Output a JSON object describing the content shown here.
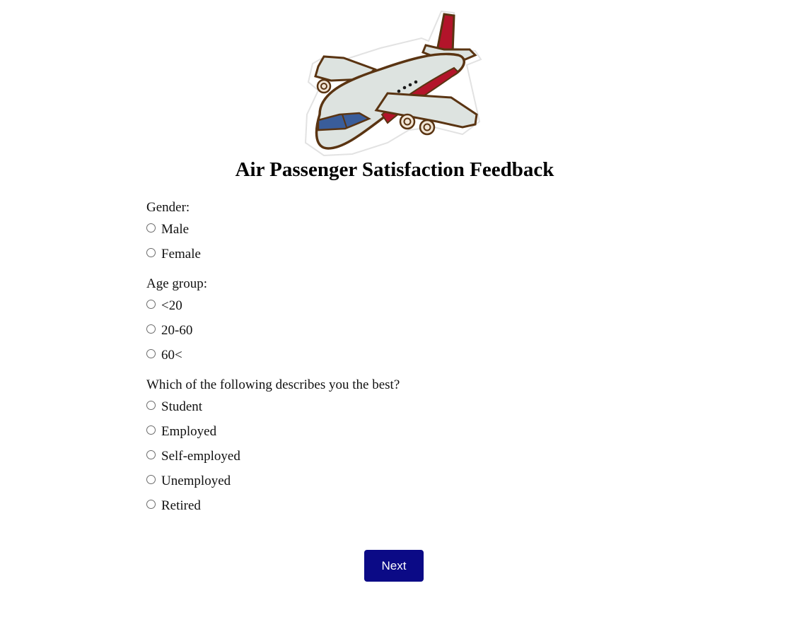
{
  "page": {
    "title": "Air Passenger Satisfaction Feedback",
    "logo_icon": "airplane-icon"
  },
  "questions": [
    {
      "label": "Gender:",
      "options": [
        "Male",
        "Female"
      ]
    },
    {
      "label": "Age group:",
      "options": [
        "<20",
        "20-60",
        "60<"
      ]
    },
    {
      "label": "Which of the following describes you the best?",
      "options": [
        "Student",
        "Employed",
        "Self-employed",
        "Unemployed",
        "Retired"
      ]
    }
  ],
  "actions": {
    "next_label": "Next"
  },
  "colors": {
    "button_bg": "#0b0a86",
    "button_text": "#ffffff",
    "plane_body": "#dde3e0",
    "plane_accent": "#b3142a",
    "plane_outline": "#5a3412",
    "plane_window": "#3a5d9a"
  }
}
